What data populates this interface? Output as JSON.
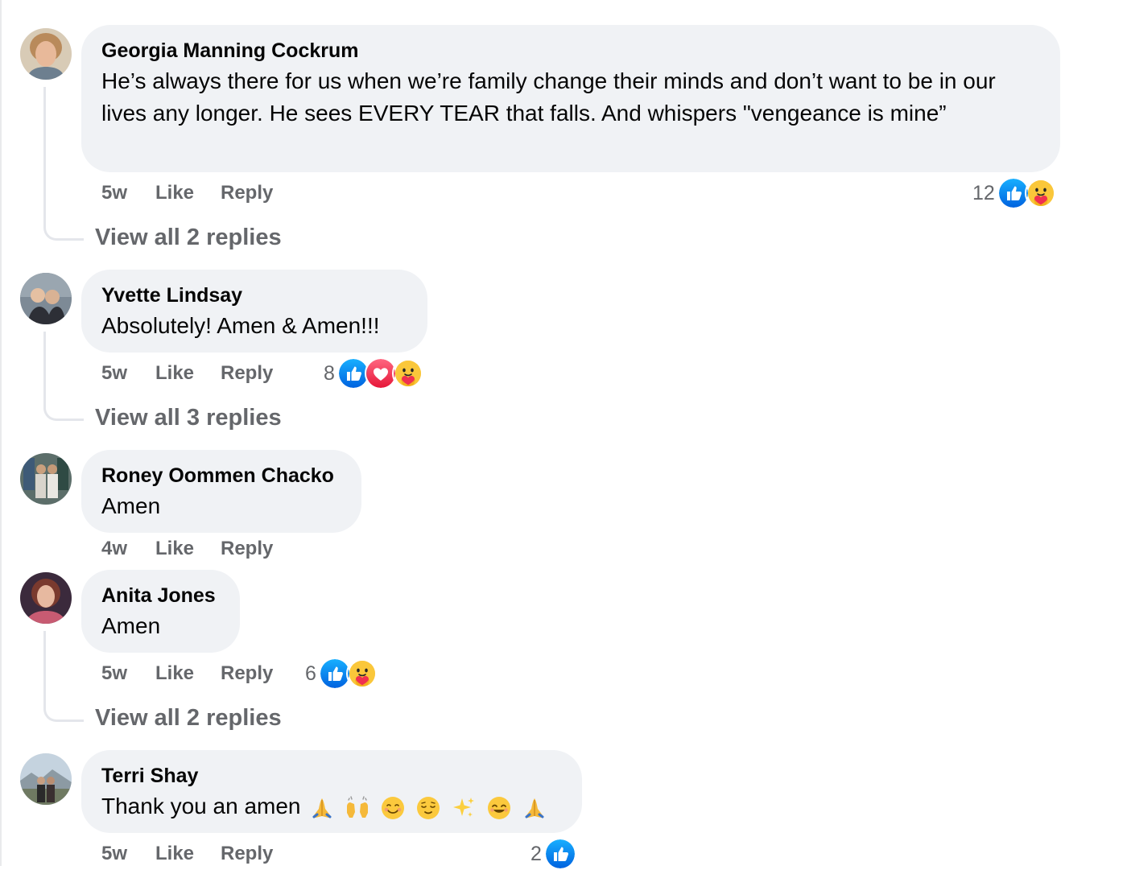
{
  "comments": [
    {
      "author": "Georgia Manning Cockrum",
      "text": "He’s always there for us when we’re family change their minds and don’t want to be in our lives any longer. He sees EVERY TEAR that falls. And whispers \"vengeance is mine”",
      "age": "5w",
      "like_label": "Like",
      "reply_label": "Reply",
      "reaction_count": "12",
      "reactions": [
        "like-icon",
        "care-icon"
      ],
      "view_replies": "View all 2 replies"
    },
    {
      "author": "Yvette Lindsay",
      "text": "Absolutely! Amen & Amen!!!",
      "age": "5w",
      "like_label": "Like",
      "reply_label": "Reply",
      "reaction_count": "8",
      "reactions": [
        "like-icon",
        "love-icon",
        "care-icon"
      ],
      "view_replies": "View all 3 replies"
    },
    {
      "author": "Roney Oommen Chacko",
      "text": "Amen",
      "age": "4w",
      "like_label": "Like",
      "reply_label": "Reply"
    },
    {
      "author": "Anita Jones",
      "text": "Amen",
      "age": "5w",
      "like_label": "Like",
      "reply_label": "Reply",
      "reaction_count": "6",
      "reactions": [
        "like-icon",
        "care-icon"
      ],
      "view_replies": "View all 2 replies"
    },
    {
      "author": "Terri Shay",
      "text": "Thank you an amen",
      "text_emojis": [
        "folded-hands-emoji",
        "raising-hands-emoji",
        "smiling-face-emoji",
        "relieved-face-emoji",
        "sparkles-emoji",
        "smiling-eyes-emoji",
        "folded-hands-emoji"
      ],
      "age": "5w",
      "like_label": "Like",
      "reply_label": "Reply",
      "reaction_count": "2",
      "reactions": [
        "like-icon"
      ]
    }
  ],
  "colors": {
    "bubble": "#f0f2f5",
    "secondary_text": "#65676b",
    "like_blue": "#1b74e4",
    "love_red": "#f02849",
    "care_yellow": "#f7b125"
  }
}
